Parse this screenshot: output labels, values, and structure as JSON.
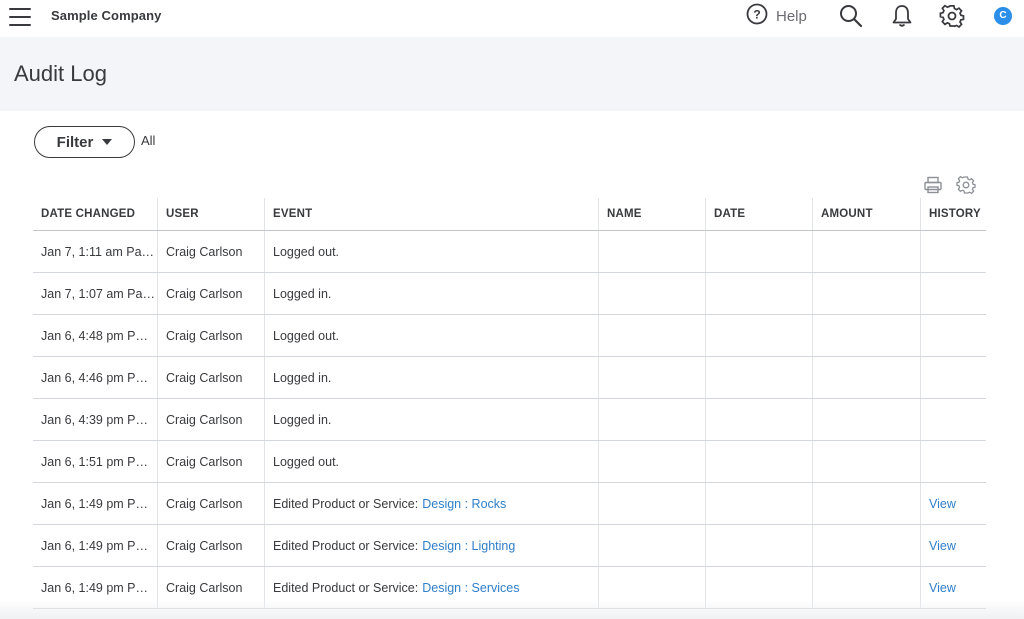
{
  "topbar": {
    "company": "Sample Company",
    "help_label": "Help",
    "avatar_initial": "C",
    "icons": [
      "menu-icon",
      "help-icon",
      "search-icon",
      "bell-icon",
      "gear-icon"
    ]
  },
  "page": {
    "title": "Audit Log"
  },
  "filter": {
    "button_label": "Filter",
    "value": "All"
  },
  "table": {
    "columns": [
      "DATE CHANGED",
      "USER",
      "EVENT",
      "NAME",
      "DATE",
      "AMOUNT",
      "HISTORY"
    ],
    "rows": [
      {
        "date_changed": "Jan 7, 1:11 am Pa…",
        "user": "Craig Carlson",
        "event": "Logged out.",
        "event_link": "",
        "name": "",
        "date": "",
        "amount": "",
        "history": ""
      },
      {
        "date_changed": "Jan 7, 1:07 am Pa…",
        "user": "Craig Carlson",
        "event": "Logged in.",
        "event_link": "",
        "name": "",
        "date": "",
        "amount": "",
        "history": ""
      },
      {
        "date_changed": "Jan 6, 4:48 pm P…",
        "user": "Craig Carlson",
        "event": "Logged out.",
        "event_link": "",
        "name": "",
        "date": "",
        "amount": "",
        "history": ""
      },
      {
        "date_changed": "Jan 6, 4:46 pm P…",
        "user": "Craig Carlson",
        "event": "Logged in.",
        "event_link": "",
        "name": "",
        "date": "",
        "amount": "",
        "history": ""
      },
      {
        "date_changed": "Jan 6, 4:39 pm P…",
        "user": "Craig Carlson",
        "event": "Logged in.",
        "event_link": "",
        "name": "",
        "date": "",
        "amount": "",
        "history": ""
      },
      {
        "date_changed": "Jan 6, 1:51 pm P…",
        "user": "Craig Carlson",
        "event": "Logged out.",
        "event_link": "",
        "name": "",
        "date": "",
        "amount": "",
        "history": ""
      },
      {
        "date_changed": "Jan 6, 1:49 pm P…",
        "user": "Craig Carlson",
        "event": "Edited Product or Service:",
        "event_link": "Design : Rocks",
        "name": "",
        "date": "",
        "amount": "",
        "history": "View"
      },
      {
        "date_changed": "Jan 6, 1:49 pm P…",
        "user": "Craig Carlson",
        "event": "Edited Product or Service:",
        "event_link": "Design : Lighting",
        "name": "",
        "date": "",
        "amount": "",
        "history": "View"
      },
      {
        "date_changed": "Jan 6, 1:49 pm P…",
        "user": "Craig Carlson",
        "event": "Edited Product or Service:",
        "event_link": "Design : Services",
        "name": "",
        "date": "",
        "amount": "",
        "history": "View"
      }
    ]
  },
  "colors": {
    "link": "#2f7ec9",
    "avatar": "#2b8fea",
    "header_band": "#f4f5f8",
    "text": "#393a3d"
  }
}
